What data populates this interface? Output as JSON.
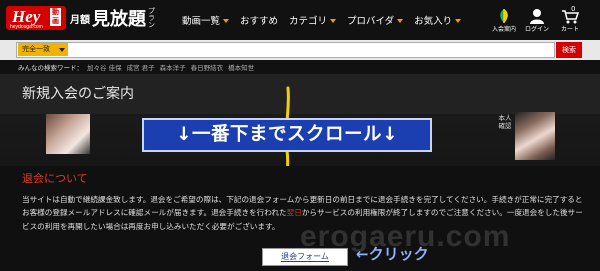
{
  "header": {
    "logo_text": "Hey",
    "logo_sub": "heydouga.com",
    "logo_badge": "動画",
    "plan_prefix": "月額",
    "plan_main": "見放題",
    "plan_suffix": "プラン",
    "nav": [
      {
        "label": "動画一覧",
        "has_dropdown": true
      },
      {
        "label": "おすすめ",
        "has_dropdown": false
      },
      {
        "label": "カテゴリ",
        "has_dropdown": true
      },
      {
        "label": "プロバイダ",
        "has_dropdown": true
      },
      {
        "label": "お気入り",
        "has_dropdown": true
      }
    ],
    "icons": [
      {
        "icon": "leaf-icon",
        "label": "入会案内"
      },
      {
        "icon": "user-icon",
        "label": "ログイン"
      },
      {
        "icon": "cart-icon",
        "label": "カート",
        "count": "0"
      }
    ]
  },
  "search": {
    "match_mode": "完全一致",
    "query": "",
    "button_label": "検索"
  },
  "keywords": {
    "label": "みんなの検索ワード：",
    "items": [
      "加々谷 佳保",
      "成宮 君子",
      "森本洋子",
      "春日野結衣",
      "橋本知世"
    ]
  },
  "page": {
    "title": "新規入会のご案内"
  },
  "banner": {
    "scroll_callout": "↓一番下までスクロール↓",
    "right_caption": "本人確認"
  },
  "content": {
    "section_title": "退会について",
    "para_1": "当サイトは自動で継続課金致します。退会をご希望の際は、下記の退会フォームから更新日の前日までに退会手続きを完了してください。手続きが正常に完了するとお客様の登録メールアドレスに確認メールが届きます。退会手続きを行われた",
    "para_highlight": "翌日",
    "para_2": "からサービスの利用権限が終了しますのでご注意ください。一度退会をした後サービスの利用を再開したい場合は再度お申し込みいただく必要がございます。",
    "watermark": "erogaeru.com",
    "form_button": "退会フォーム",
    "click_callout": "←クリック"
  },
  "colors": {
    "brand_red": "#d40000",
    "accent_orange": "#f0b400",
    "section_red": "#e23a28",
    "callout_blue": "#1b3fb0"
  }
}
